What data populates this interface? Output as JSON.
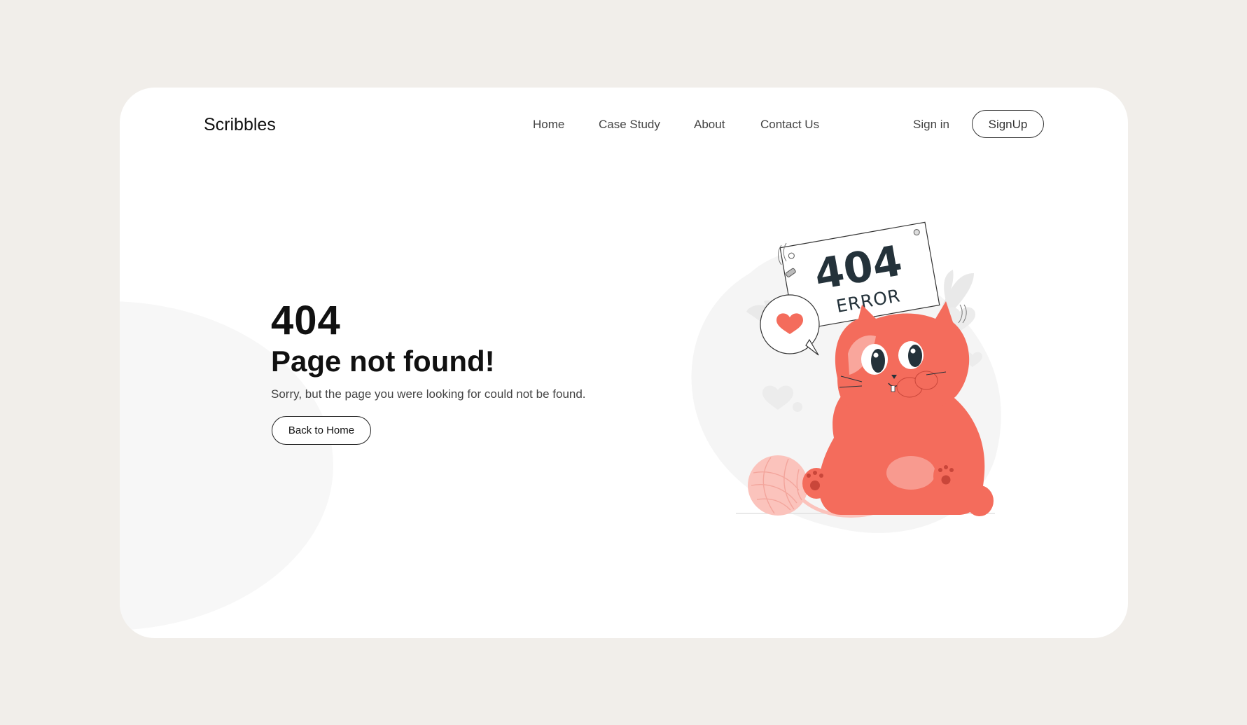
{
  "brand": {
    "name": "Scribbles"
  },
  "nav": {
    "items": [
      {
        "label": "Home"
      },
      {
        "label": "Case Study"
      },
      {
        "label": "About"
      },
      {
        "label": "Contact Us"
      }
    ]
  },
  "auth": {
    "signin_label": "Sign in",
    "signup_label": "SignUp"
  },
  "hero": {
    "code": "404",
    "title": "Page not found!",
    "subtitle": "Sorry, but the page you were looking for could not be found.",
    "button_label": "Back to Home"
  },
  "illustration": {
    "sign_code": "404",
    "sign_text": "ERROR",
    "colors": {
      "cat": "#f46c5c",
      "cat_light": "#f9a69c",
      "yarn": "#fbc3bc",
      "sign_ink": "#24323a",
      "blob": "#f5f5f5"
    }
  },
  "colors": {
    "page_bg": "#f1eeea",
    "card_bg": "#ffffff",
    "text_dark": "#111111",
    "text_muted": "#444444"
  }
}
